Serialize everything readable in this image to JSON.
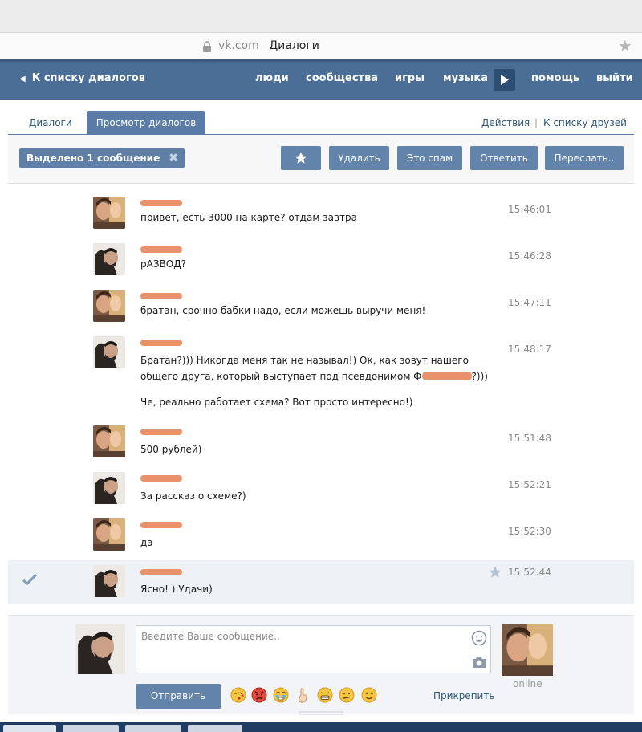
{
  "browser": {
    "domain": "vk.com",
    "page_title": "Диалоги"
  },
  "topnav": {
    "back_label": "К списку диалогов",
    "links": [
      "люди",
      "сообщества",
      "игры",
      "музыка",
      "помощь",
      "выйти"
    ]
  },
  "tabs": {
    "dialogs": "Диалоги",
    "view_dialogs": "Просмотр диалогов",
    "actions": "Действия",
    "separator": "|",
    "to_friends": "К списку друзей"
  },
  "toolbar": {
    "selected_label": "Выделено 1 сообщение",
    "delete": "Удалить",
    "spam": "Это спам",
    "reply": "Ответить",
    "forward": "Переслать.."
  },
  "messages": [
    {
      "author": "friend",
      "time": "15:46:01",
      "lines": [
        "привет, есть 3000 на карте? отдам завтра"
      ]
    },
    {
      "author": "me",
      "time": "15:46:28",
      "lines": [
        "рАЗВОД?"
      ]
    },
    {
      "author": "friend",
      "time": "15:47:11",
      "lines": [
        "братан, срочно бабки надо, если можешь выручи меня!"
      ]
    },
    {
      "author": "me",
      "time": "15:48:17",
      "lines": [
        "Братан?))) Никогда меня так не называл!) Ок, как зовут нашего",
        "общего друга, который выступает под псевдонимом Ф",
        "?)))",
        "Че, реально работает схема? Вот просто интересно!)"
      ]
    },
    {
      "author": "friend",
      "time": "15:51:48",
      "lines": [
        "500 рублей)"
      ]
    },
    {
      "author": "me",
      "time": "15:52:21",
      "lines": [
        "За рассказ о схеме?)"
      ]
    },
    {
      "author": "friend",
      "time": "15:52:30",
      "lines": [
        "да"
      ]
    },
    {
      "author": "me",
      "time": "15:52:44",
      "lines": [
        "Ясно! ) Удачи)"
      ],
      "selected": true
    }
  ],
  "composer": {
    "placeholder": "Введите Ваше сообщение..",
    "send": "Отправить",
    "attach": "Прикрепить",
    "online": "online",
    "emojis": [
      "kiss-emoji",
      "angry-emoji",
      "crying-emoji",
      "finger-up-emoji",
      "grin-emoji",
      "confused-emoji",
      "wink-emoji"
    ]
  },
  "colors": {
    "nav_bg": "#4a6e96",
    "button_bg": "#6384aa",
    "link": "#2b587a",
    "redaction": "#e8916a"
  }
}
